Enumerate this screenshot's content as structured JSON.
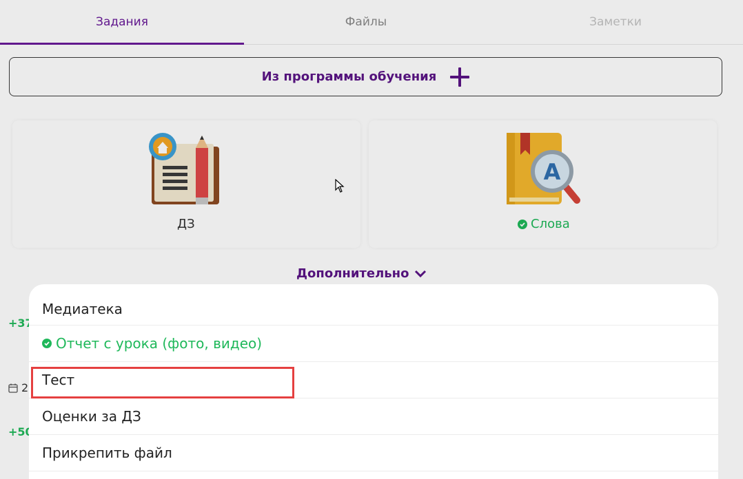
{
  "tabs": [
    {
      "label": "Задания"
    },
    {
      "label": "Файлы"
    },
    {
      "label": "Заметки"
    }
  ],
  "program_button": {
    "label": "Из программы обучения"
  },
  "cards": [
    {
      "label": "ДЗ",
      "icon": "homework-book-icon"
    },
    {
      "label": "Слова",
      "icon": "dictionary-search-icon",
      "completed": true
    }
  ],
  "more_toggle": {
    "label": "Дополнительно"
  },
  "background_list": {
    "amount_1": "+37",
    "date_1": "2",
    "amount_2": "+50"
  },
  "menu": {
    "items": [
      {
        "label": "Медиатека"
      },
      {
        "label": "Отчет с урока (фото, видео)",
        "completed": true
      },
      {
        "label": "Тест",
        "highlighted": true
      },
      {
        "label": "Оценки за ДЗ"
      },
      {
        "label": "Прикрепить файл"
      }
    ]
  },
  "colors": {
    "accent": "#5b1486",
    "success": "#1fb85a",
    "highlight": "#e54040"
  }
}
